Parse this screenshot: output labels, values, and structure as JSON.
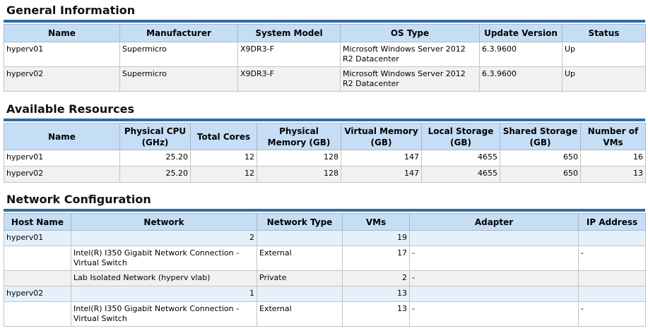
{
  "general": {
    "title": "General Information",
    "headers": [
      "Name",
      "Manufacturer",
      "System Model",
      "OS Type",
      "Update Version",
      "Status"
    ],
    "rows": [
      [
        "hyperv01",
        "Supermicro",
        "X9DR3-F",
        "Microsoft Windows Server 2012 R2 Datacenter",
        "6.3.9600",
        "Up"
      ],
      [
        "hyperv02",
        "Supermicro",
        "X9DR3-F",
        "Microsoft Windows Server 2012 R2 Datacenter",
        "6.3.9600",
        "Up"
      ]
    ]
  },
  "resources": {
    "title": "Available Resources",
    "headers": [
      "Name",
      "Physical CPU (GHz)",
      "Total Cores",
      "Physical Memory (GB)",
      "Virtual Memory (GB)",
      "Local Storage (GB)",
      "Shared Storage (GB)",
      "Number of VMs"
    ],
    "rows": [
      [
        "hyperv01",
        "25.20",
        "12",
        "128",
        "147",
        "4655",
        "650",
        "16"
      ],
      [
        "hyperv02",
        "25.20",
        "12",
        "128",
        "147",
        "4655",
        "650",
        "13"
      ]
    ]
  },
  "network": {
    "title": "Network Configuration",
    "headers": [
      "Host Name",
      "Network",
      "Network Type",
      "VMs",
      "Adapter",
      "IP Address"
    ],
    "rows": [
      [
        "hyperv01",
        "2",
        "",
        "19",
        "",
        ""
      ],
      [
        "",
        "Intel(R) I350 Gigabit Network Connection - Virtual Switch",
        "External",
        "17",
        "-",
        "-"
      ],
      [
        "",
        "Lab Isolated Network (hyperv vlab)",
        "Private",
        "2",
        "-",
        ""
      ],
      [
        "hyperv02",
        "1",
        "",
        "13",
        "",
        ""
      ],
      [
        "",
        "Intel(R) I350 Gigabit Network Connection - Virtual Switch",
        "External",
        "13",
        "-",
        "-"
      ]
    ]
  }
}
